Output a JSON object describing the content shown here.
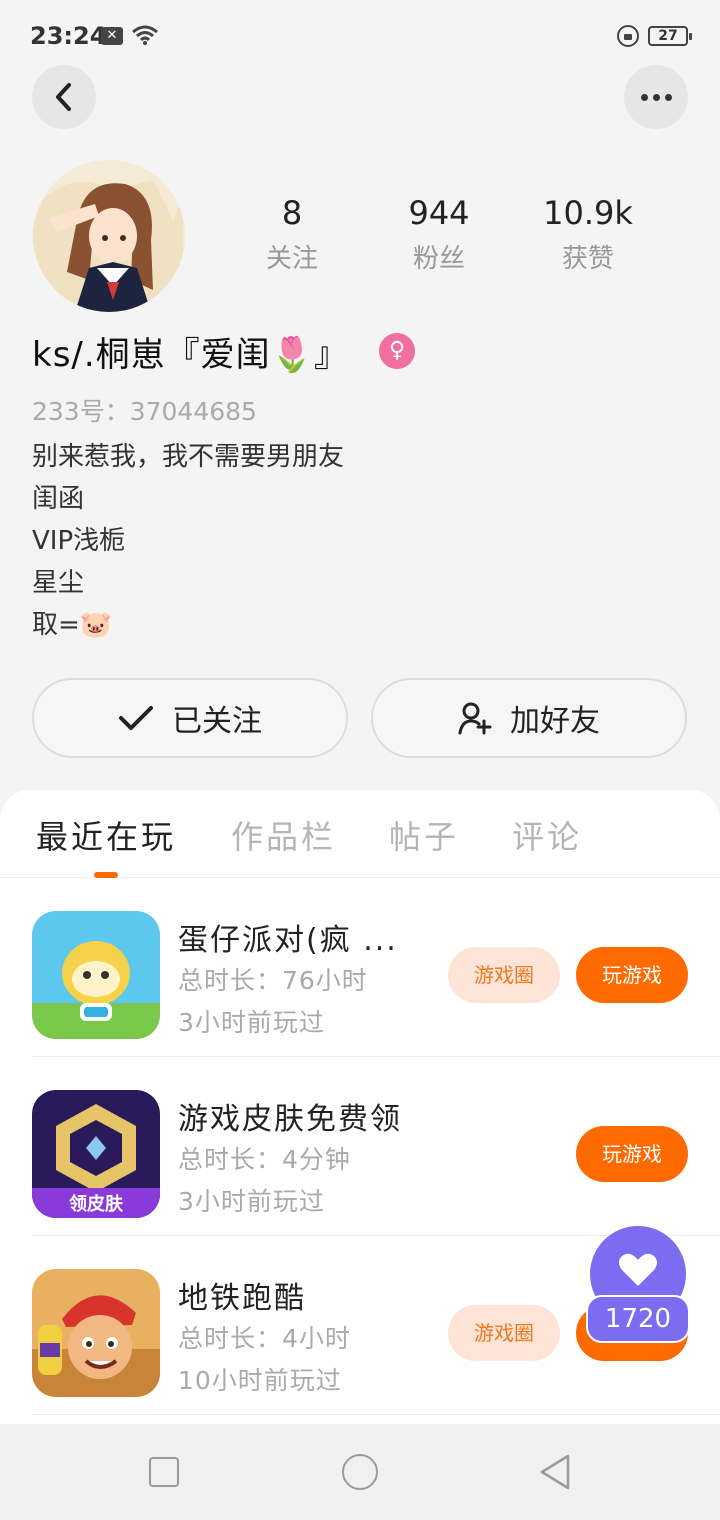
{
  "status_bar": {
    "time": "23:24",
    "battery": "27"
  },
  "profile": {
    "stats": [
      {
        "value": "8",
        "label": "关注"
      },
      {
        "value": "944",
        "label": "粉丝"
      },
      {
        "value": "10.9k",
        "label": "获赞"
      }
    ],
    "name": "ks/.桐崽『爱闺🌷』",
    "gender_symbol": "♀",
    "uid": "233号：37044685",
    "bio_lines": [
      "别来惹我，我不需要男朋友",
      "闺函",
      "VIP浅栀",
      "星尘",
      "取=🐷"
    ]
  },
  "actions": {
    "follow_label": "已关注",
    "add_friend_label": "加好友"
  },
  "tabs": [
    "最近在玩",
    "作品栏",
    "帖子",
    "评论"
  ],
  "games": [
    {
      "title": "蛋仔派对(疯 ...",
      "duration": "总时长：76小时",
      "last_played": "3小时前玩过",
      "circle_label": "游戏圈",
      "play_label": "玩游戏",
      "icon": "eggy-party-icon"
    },
    {
      "title": "游戏皮肤免费领",
      "duration": "总时长：4分钟",
      "last_played": "3小时前玩过",
      "play_label": "玩游戏",
      "icon_text": "领皮肤",
      "icon": "skin-app-icon"
    },
    {
      "title": "地铁跑酷",
      "duration": "总时长：4小时",
      "last_played": "10小时前玩过",
      "circle_label": "游戏圈",
      "play_label": "玩游戏",
      "icon": "subway-surfers-icon"
    }
  ],
  "like": {
    "count": "1720"
  },
  "colors": {
    "accent": "#ff6a00",
    "like": "#7c6cf2",
    "female": "#f06ea0"
  }
}
